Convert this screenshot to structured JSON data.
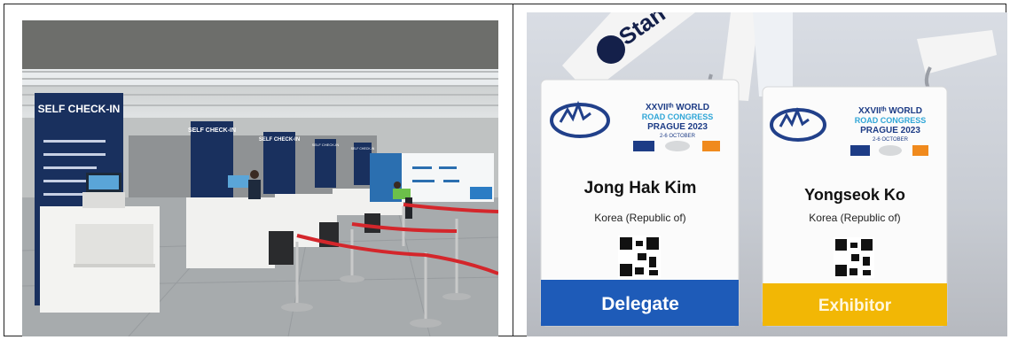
{
  "left_photo": {
    "signs": {
      "main": "SELF CHECK-IN",
      "second": "SELF CHECK-IN",
      "third": "SELF CHECK-IN",
      "fourth": "SELF CHECK-IN",
      "fifth": "SELF CHECK-IN"
    }
  },
  "right_photo": {
    "lanyard_text": "Stan",
    "event_title": "XXVIIᵗʰ WORLD",
    "event_title_2": "ROAD CONGRESS",
    "event_city_year": "PRAGUE 2023",
    "event_dates": "2-6 OCTOBER",
    "badges": [
      {
        "name": "Jong Hak Kim",
        "country": "Korea (Republic of)",
        "role": "Delegate",
        "role_color": "#1e5bb8"
      },
      {
        "name": "Yongseok Ko",
        "country": "Korea (Republic of)",
        "role": "Exhibitor",
        "role_color": "#f2b705"
      }
    ]
  }
}
